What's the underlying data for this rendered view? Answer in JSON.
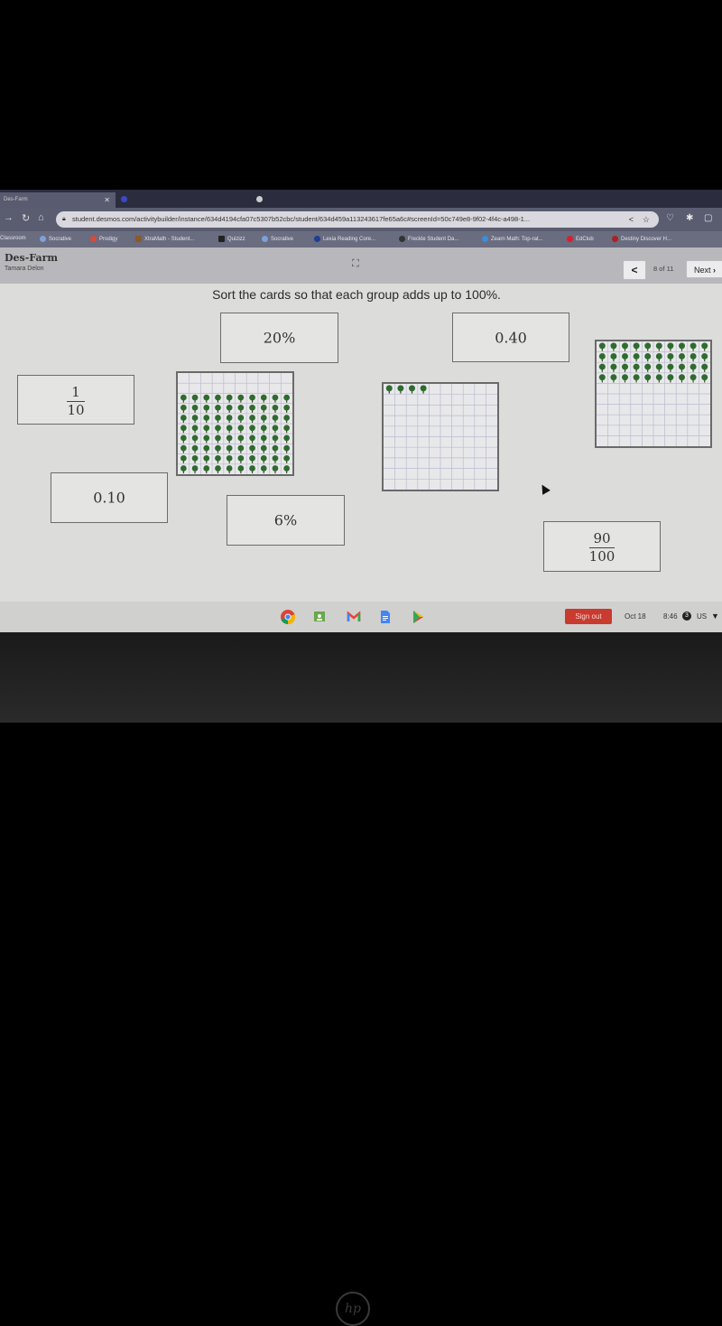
{
  "browser": {
    "tabs": [
      {
        "label": "Des-Farm",
        "active": true
      },
      {
        "label": "",
        "active": false
      },
      {
        "label": "",
        "active": false
      }
    ],
    "url": "student.desmos.com/activitybuilder/instance/634d4194cfa07c5307b52cbc/student/634d459a113243617fe65a6c#screenId=50c749e8-9f02-4f4c-a498-1...",
    "bookmarks": [
      {
        "label": "Classroom",
        "color": "#2e7d32"
      },
      {
        "label": "Socrative",
        "color": "#7da1d8"
      },
      {
        "label": "Prodigy",
        "color": "#d84a3a"
      },
      {
        "label": "XtraMath - Student...",
        "color": "#8a5a2a"
      },
      {
        "label": "Quizizz",
        "color": "#222222"
      },
      {
        "label": "Socrative",
        "color": "#7da1d8"
      },
      {
        "label": "Lexia Reading Core...",
        "color": "#1c3f94"
      },
      {
        "label": "Freckle Student Da...",
        "color": "#333333"
      },
      {
        "label": "Zearn Math: Top-rat...",
        "color": "#3a8fd8"
      },
      {
        "label": "EdClub",
        "color": "#d8202a"
      },
      {
        "label": "Destiny Discover H...",
        "color": "#aa2222"
      }
    ]
  },
  "activity": {
    "title": "Des-Farm",
    "student": "Tamara Delon",
    "page_indicator": "8 of 11",
    "prev_label": "<",
    "next_label": "Next",
    "prompt": "Sort the cards so that each group adds up to 100%."
  },
  "cards": [
    {
      "id": "card-20-percent",
      "type": "text",
      "value": "20%"
    },
    {
      "id": "card-0-40",
      "type": "text",
      "value": "0.40"
    },
    {
      "id": "card-one-tenth",
      "type": "fraction",
      "numerator": "1",
      "denominator": "10"
    },
    {
      "id": "card-0-10",
      "type": "text",
      "value": "0.10"
    },
    {
      "id": "card-6-percent",
      "type": "text",
      "value": "6%"
    },
    {
      "id": "card-90-hundredths",
      "type": "fraction",
      "numerator": "90",
      "denominator": "100"
    }
  ],
  "grids": [
    {
      "id": "grid-80-trees",
      "trees": 80,
      "tree_rows_from_bottom": true
    },
    {
      "id": "grid-4-trees",
      "trees": 4,
      "tree_rows_from_bottom": false
    },
    {
      "id": "grid-40-trees",
      "trees": 40,
      "tree_rows_from_bottom": false
    }
  ],
  "shelf": {
    "apps": [
      "chrome",
      "classroom",
      "gmail",
      "docs",
      "play-store"
    ],
    "sign_out_label": "Sign out",
    "date": "Oct 18",
    "time": "8:46",
    "notification_count": "3",
    "locale": "US"
  },
  "colors": {
    "tree_green": "#2f6b2f",
    "sign_out_red": "#c93a2f"
  }
}
